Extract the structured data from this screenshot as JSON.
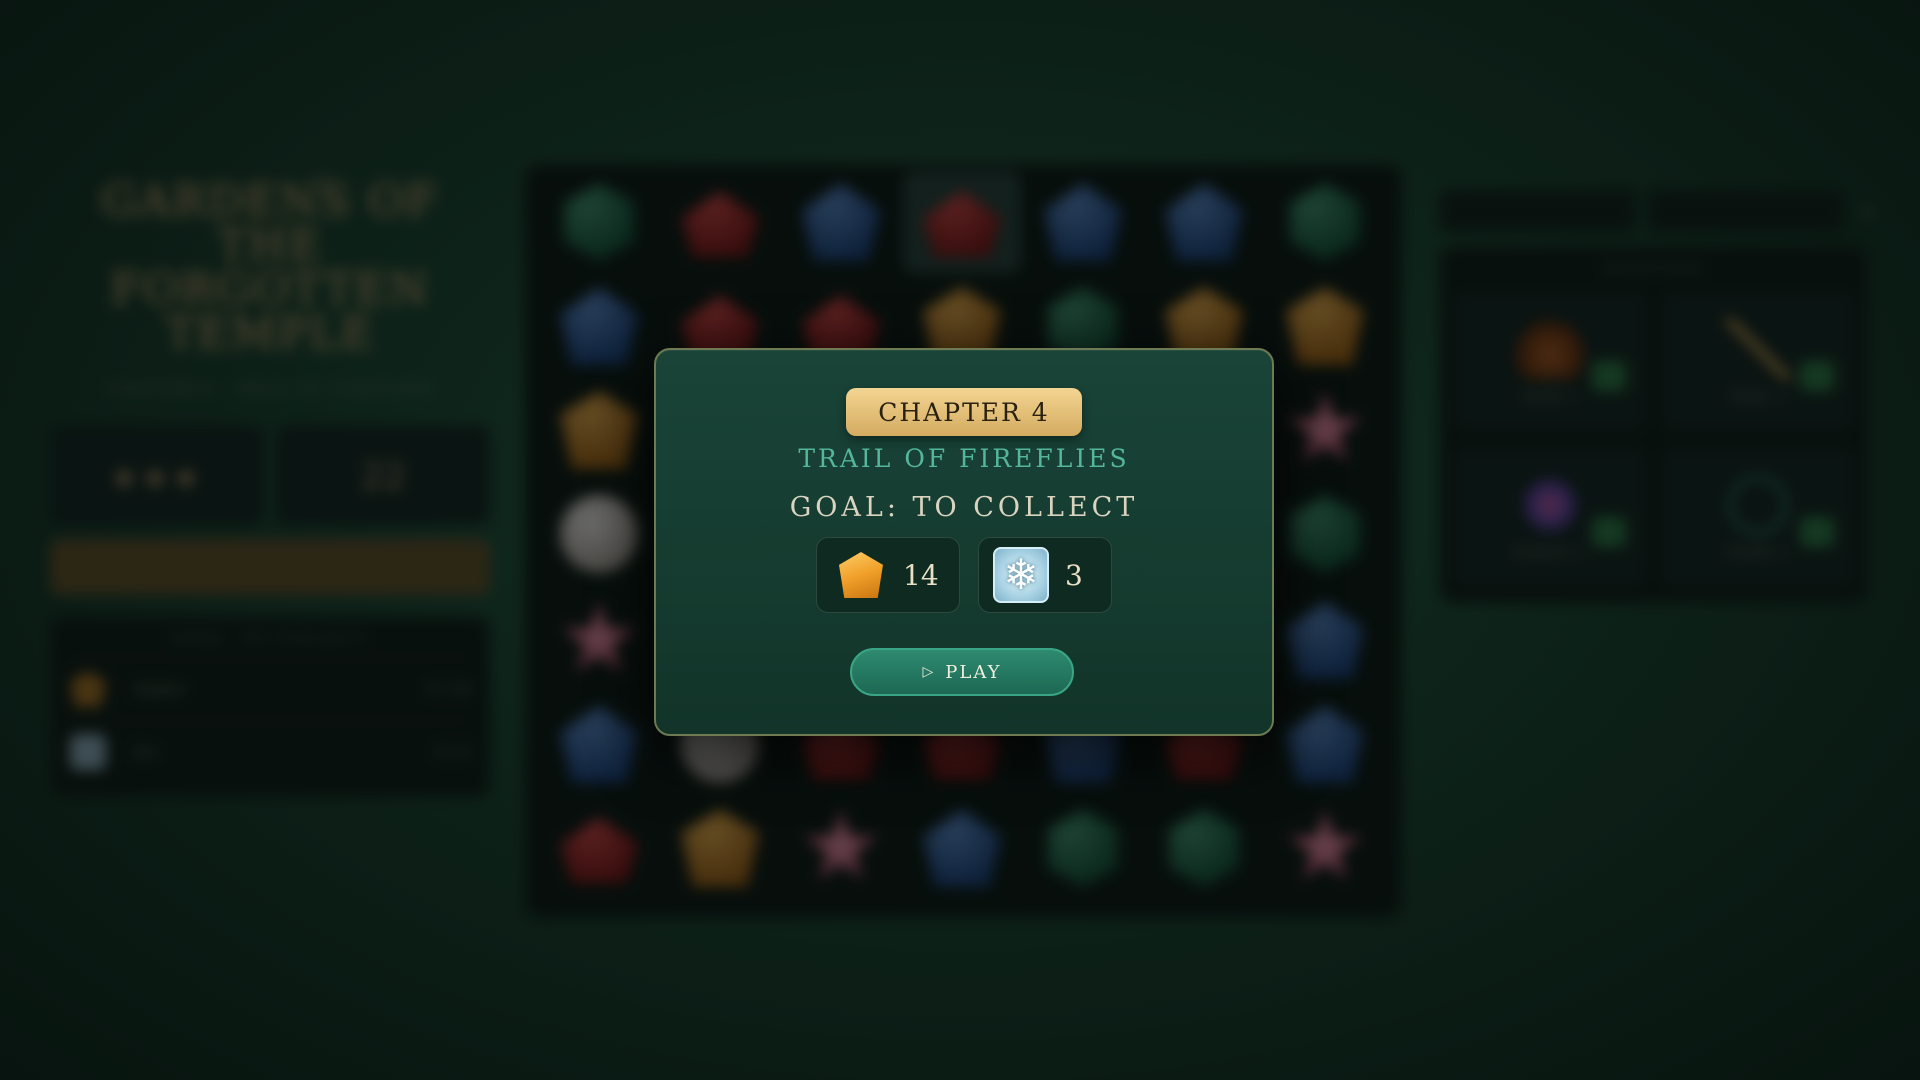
{
  "background": {
    "game_title": "GARDENS OF THE FORGOTTEN TEMPLE",
    "subtitle": "CHAPTER 4 · TRAIL OF FIREFLIES",
    "moves_value": "22",
    "stars": "★★★",
    "goals_title": "GOAL: TO COLLECT",
    "goals": [
      {
        "icon": "amber-gem-icon",
        "name": "Amber",
        "count": "0 / 14"
      },
      {
        "icon": "ice-tile-icon",
        "name": "Ice",
        "count": "0 / 3"
      }
    ],
    "boosters_title": "BOOSTERS",
    "boosters": [
      {
        "icon": "bomb-icon",
        "label": "Bomb ×"
      },
      {
        "icon": "magic-wand-icon",
        "label": "Magic ×"
      },
      {
        "icon": "rainbow-icon",
        "label": "Rainbow ×"
      },
      {
        "icon": "shuffle-icon",
        "label": "Shuffle ×"
      }
    ],
    "board": [
      [
        "green",
        "red",
        "blue",
        "red",
        "blue",
        "blue",
        "green"
      ],
      [
        "blue",
        "red",
        "red",
        "amber",
        "green",
        "amber",
        "amber"
      ],
      [
        "amber",
        "",
        "",
        "",
        "",
        "",
        "star"
      ],
      [
        "pearl",
        "",
        "",
        "",
        "",
        "",
        "green"
      ],
      [
        "star",
        "",
        "",
        "",
        "",
        "",
        "blue"
      ],
      [
        "blue",
        "pearl",
        "red",
        "red",
        "blue",
        "red",
        "blue"
      ],
      [
        "red",
        "amber",
        "star",
        "blue",
        "green",
        "green",
        "star"
      ]
    ]
  },
  "modal": {
    "chapter_label": "CHAPTER 4",
    "chapter_name": "TRAIL OF FIREFLIES",
    "goal_heading": "GOAL: TO COLLECT",
    "goals": [
      {
        "icon": "amber-gem-icon",
        "count": "14"
      },
      {
        "icon": "ice-tile-icon",
        "count": "3"
      }
    ],
    "play_label": "PLAY",
    "play_icon": "▷"
  },
  "colors": {
    "gold": "#d4ab60",
    "teal_text": "#54b79b",
    "play_button": "#2e8a70",
    "panel_bg": "#1a4438"
  }
}
